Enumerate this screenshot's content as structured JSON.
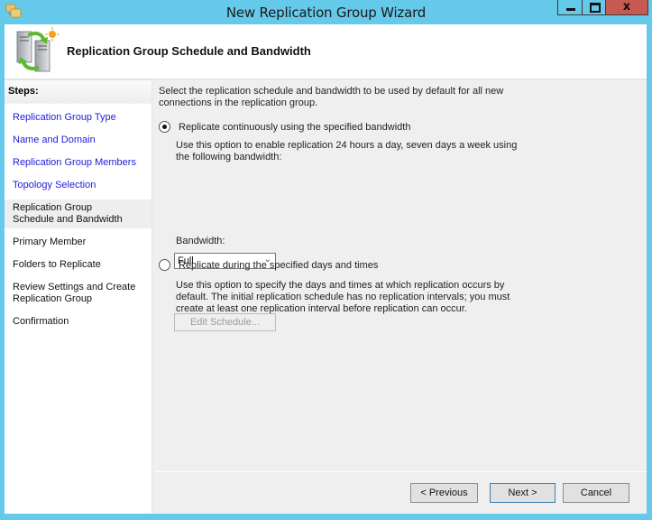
{
  "window": {
    "title": "New Replication Group Wizard",
    "app_icon": "folder-replication-icon",
    "controls": {
      "minimize": "minimize-icon",
      "maximize": "maximize-icon",
      "close_label": "x"
    }
  },
  "header": {
    "icon": "server-replication-icon",
    "title": "Replication Group Schedule and Bandwidth"
  },
  "sidebar": {
    "heading": "Steps:",
    "steps": [
      {
        "label": "Replication Group Type",
        "state": "completed"
      },
      {
        "label": "Name and Domain",
        "state": "completed"
      },
      {
        "label": "Replication Group Members",
        "state": "completed"
      },
      {
        "label": "Topology Selection",
        "state": "completed"
      },
      {
        "label": "Replication Group Schedule and Bandwidth",
        "state": "current"
      },
      {
        "label": "Primary Member",
        "state": "pending"
      },
      {
        "label": "Folders to Replicate",
        "state": "pending"
      },
      {
        "label": "Review Settings and Create Replication Group",
        "state": "pending"
      },
      {
        "label": "Confirmation",
        "state": "pending"
      }
    ]
  },
  "main": {
    "intro": "Select the replication schedule and bandwidth to be used by default for all new connections in the replication group.",
    "option_continuous": {
      "label": "Replicate continuously using the specified bandwidth",
      "selected": true,
      "description": "Use this option to enable replication 24 hours a day, seven days a week using the following bandwidth:"
    },
    "bandwidth": {
      "label": "Bandwidth:",
      "value": "Full"
    },
    "option_scheduled": {
      "label": "Replicate during the specified days and times",
      "selected": false,
      "description": "Use this option to specify the days and times at which replication occurs by default. The initial replication schedule has no replication intervals; you must create at least one replication interval before replication can occur."
    },
    "edit_schedule_label": "Edit Schedule..."
  },
  "footer": {
    "previous_label": "< Previous",
    "next_label": "Next >",
    "cancel_label": "Cancel"
  }
}
